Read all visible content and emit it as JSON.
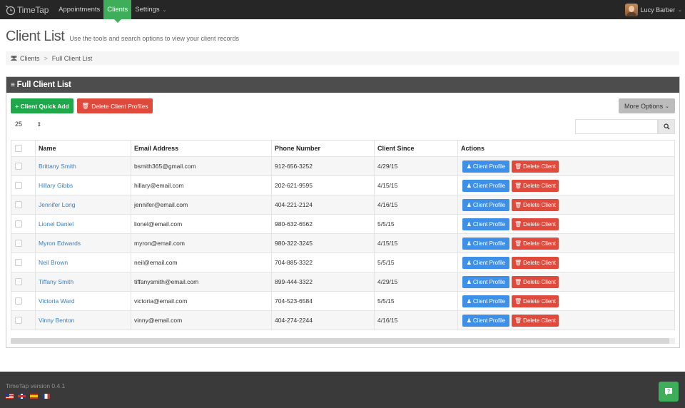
{
  "nav": {
    "brand": "TimeTap",
    "items": [
      {
        "label": "Appointments"
      },
      {
        "label": "Clients"
      },
      {
        "label": "Settings"
      }
    ],
    "user_name": "Lucy Barber"
  },
  "header": {
    "title": "Client List",
    "subtitle": "Use the tools and search options to view your client records"
  },
  "breadcrumb": {
    "root": "Clients",
    "current": "Full Client List"
  },
  "panel": {
    "title": "Full Client List",
    "quick_add_label": "+ Client Quick Add",
    "delete_profiles_label": "Delete Client Profiles",
    "more_options_label": "More Options",
    "page_size": "25"
  },
  "table": {
    "headers": {
      "name": "Name",
      "email": "Email Address",
      "phone": "Phone Number",
      "since": "Client Since",
      "actions": "Actions"
    },
    "profile_button": "Client Profile",
    "delete_button": "Delete Client",
    "rows": [
      {
        "name": "Brittany Smith",
        "email": "bsmith365@gmail.com",
        "phone": "912-656-3252",
        "since": "4/29/15"
      },
      {
        "name": "Hillary Gibbs",
        "email": "hillary@email.com",
        "phone": "202-621-9595",
        "since": "4/15/15"
      },
      {
        "name": "Jennifer Long",
        "email": "jennifer@email.com",
        "phone": "404-221-2124",
        "since": "4/16/15"
      },
      {
        "name": "Lionel Daniel",
        "email": "lionel@email.com",
        "phone": "980-632-6562",
        "since": "5/5/15"
      },
      {
        "name": "Myron Edwards",
        "email": "myron@email.com",
        "phone": "980-322-3245",
        "since": "4/15/15"
      },
      {
        "name": "Neil Brown",
        "email": "neil@email.com",
        "phone": "704-885-3322",
        "since": "5/5/15"
      },
      {
        "name": "Tiffany Smith",
        "email": "tiffanysmith@email.com",
        "phone": "899-444-3322",
        "since": "4/29/15"
      },
      {
        "name": "Victoria Ward",
        "email": "victoria@email.com",
        "phone": "704-523-6584",
        "since": "5/5/15"
      },
      {
        "name": "Vinny Benton",
        "email": "vinny@email.com",
        "phone": "404-274-2244",
        "since": "4/16/15"
      }
    ]
  },
  "footer": {
    "version": "TimeTap version 0.4.1"
  },
  "colors": {
    "nav_bg": "#262626",
    "active_green": "#3fae5a",
    "add_green": "#1fa84a",
    "delete_red": "#e04a3c",
    "profile_blue": "#3d8fe8",
    "link_blue": "#3a7fc1",
    "panel_head": "#4d4d4d",
    "footer_bg": "#3a3a3a"
  },
  "icons": {
    "brand": "clock-logo-icon",
    "breadcrumb": "users-icon",
    "panel": "list-icon",
    "delete": "trash-icon",
    "profile": "user-icon",
    "search": "search-icon",
    "help": "help-icon"
  }
}
